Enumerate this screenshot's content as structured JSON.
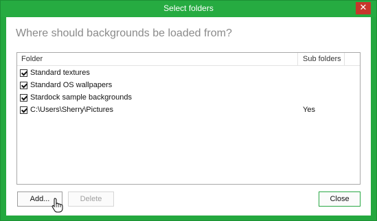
{
  "window": {
    "title": "Select folders",
    "close_glyph": "✕"
  },
  "heading": "Where should backgrounds be loaded from?",
  "list": {
    "columns": [
      "Folder",
      "Sub folders"
    ],
    "rows": [
      {
        "checked": true,
        "folder": "Standard textures",
        "sub": ""
      },
      {
        "checked": true,
        "folder": "Standard OS wallpapers",
        "sub": ""
      },
      {
        "checked": true,
        "folder": "Stardock sample backgrounds",
        "sub": ""
      },
      {
        "checked": true,
        "folder": "C:\\Users\\Sherry\\Pictures",
        "sub": "Yes"
      }
    ]
  },
  "buttons": {
    "add": "Add...",
    "delete": "Delete",
    "close": "Close"
  },
  "colors": {
    "frame": "#24a83f",
    "close_button": "#c7362b",
    "accent_border": "#2aa845"
  }
}
